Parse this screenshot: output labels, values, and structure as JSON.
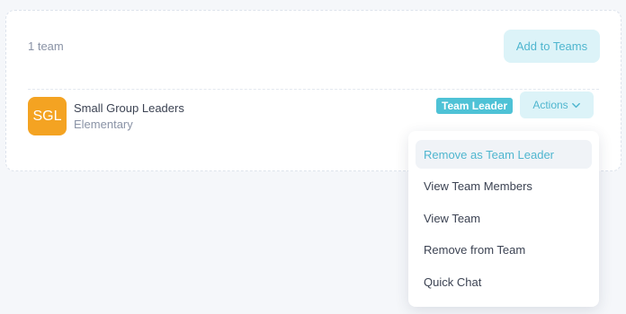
{
  "header": {
    "team_count": "1 team",
    "add_button": "Add to Teams"
  },
  "team": {
    "avatar_initials": "SGL",
    "name": "Small Group Leaders",
    "subtitle": "Elementary",
    "role_badge": "Team Leader",
    "actions_label": "Actions"
  },
  "menu": {
    "items": [
      {
        "label": "Remove as Team Leader"
      },
      {
        "label": "View Team Members"
      },
      {
        "label": "View Team"
      },
      {
        "label": "Remove from Team"
      },
      {
        "label": "Quick Chat"
      }
    ]
  },
  "colors": {
    "accent": "#4fb6cf",
    "accent_light": "#dcf3f8",
    "badge": "#4ec2d6",
    "avatar": "#f4a322"
  },
  "icons": {
    "actions_chevron": "chevron-down-icon"
  }
}
